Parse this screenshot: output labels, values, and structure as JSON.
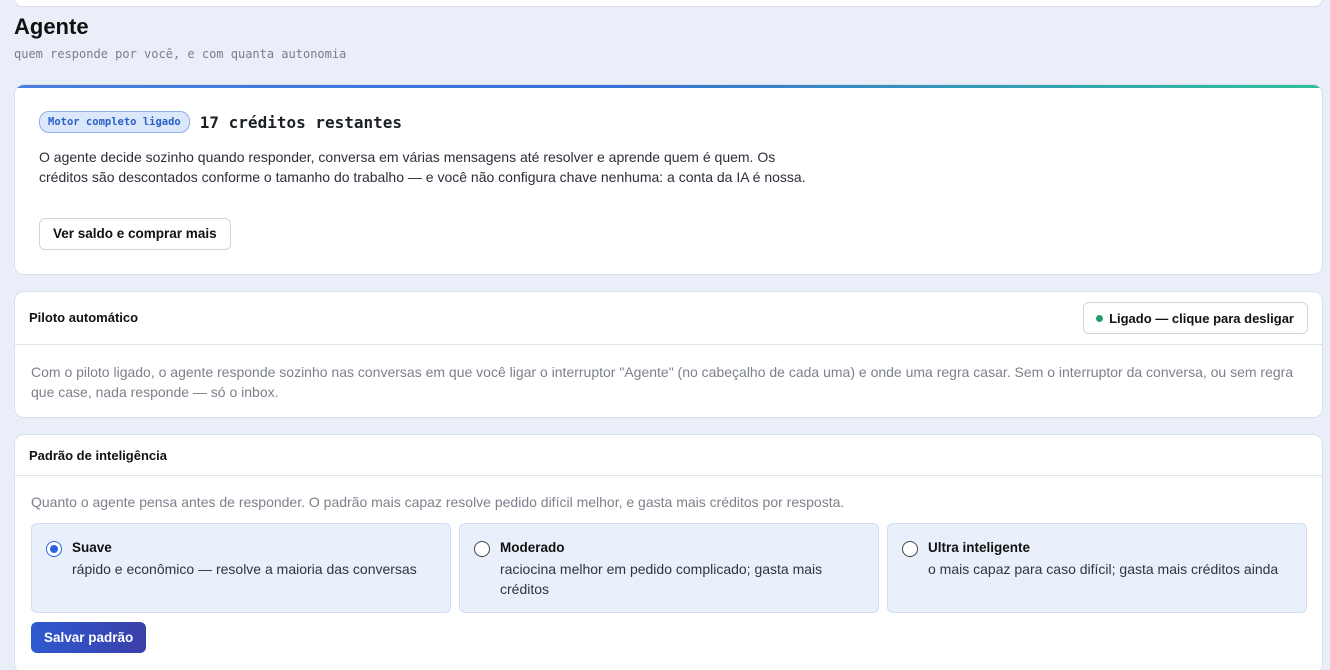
{
  "header": {
    "title": "Agente",
    "subtitle": "quem responde por você, e com quanta autonomia"
  },
  "engine": {
    "badge": "Motor completo ligado",
    "credits": "17 créditos restantes",
    "description": "O agente decide sozinho quando responder, conversa em várias mensagens até resolver e aprende quem é quem. Os créditos são descontados conforme o tamanho do trabalho — e você não configura chave nenhuma: a conta da IA é nossa.",
    "button_label": "Ver saldo e comprar mais"
  },
  "autopilot": {
    "title": "Piloto automático",
    "toggle_label": "Ligado — clique para desligar",
    "status": "on",
    "status_color": "#22a06b",
    "description": "Com o piloto ligado, o agente responde sozinho nas conversas em que você ligar o interruptor \"Agente\" (no cabeçalho de cada uma) e onde uma regra casar. Sem o interruptor da conversa, ou sem regra que case, nada responde — só o inbox."
  },
  "intelligence": {
    "title": "Padrão de inteligência",
    "description": "Quanto o agente pensa antes de responder. O padrão mais capaz resolve pedido difícil melhor, e gasta mais créditos por resposta.",
    "options": [
      {
        "title": "Suave",
        "description": "rápido e econômico — resolve a maioria das conversas",
        "selected": true
      },
      {
        "title": "Moderado",
        "description": "raciocina melhor em pedido complicado; gasta mais créditos",
        "selected": false
      },
      {
        "title": "Ultra inteligente",
        "description": "o mais capaz para caso difícil; gasta mais créditos ainda",
        "selected": false
      }
    ],
    "save_label": "Salvar padrão"
  },
  "colors": {
    "accent": "#2a64e0",
    "background": "#e9eef8"
  }
}
